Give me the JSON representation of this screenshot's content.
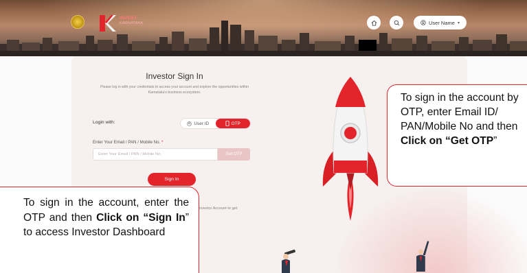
{
  "header": {
    "brand_line1": "INVEST",
    "brand_line2": "KARNATAKA",
    "user_label": "User Name"
  },
  "signin": {
    "title": "Investor Sign In",
    "subtitle": "Please log in with your credentials to access your account and explore the opportunities within Karnataka's business ecosystem.",
    "login_with": "Login with:",
    "option_userid": "User ID",
    "option_otp": "OTP",
    "field_label": "Enter Your Email / PAN / Mobile No.",
    "field_required_mark": "*",
    "field_placeholder": "Enter Your Email / PAN / Mobile No.",
    "get_otp": "Get OTP",
    "signin_button": "Sign In",
    "register_note_fragment": "nvestor Account to get"
  },
  "callouts": {
    "right": {
      "part1": "To sign in the account by OTP, enter Email ID/ PAN/Mobile No and then ",
      "bold": "Click on “Get OTP",
      "part2": "”"
    },
    "left": {
      "part1": "To sign in the account, enter the OTP and then ",
      "bold": "Click on “Sign In",
      "part2": "” to access Investor Dashboard"
    }
  },
  "colors": {
    "accent": "#e3242b",
    "card_bg": "#f6f0ee",
    "get_otp_disabled": "#e9c5c5"
  },
  "icons": {
    "home": "home-icon",
    "search": "search-icon",
    "user": "user-icon",
    "phone": "phone-icon"
  }
}
